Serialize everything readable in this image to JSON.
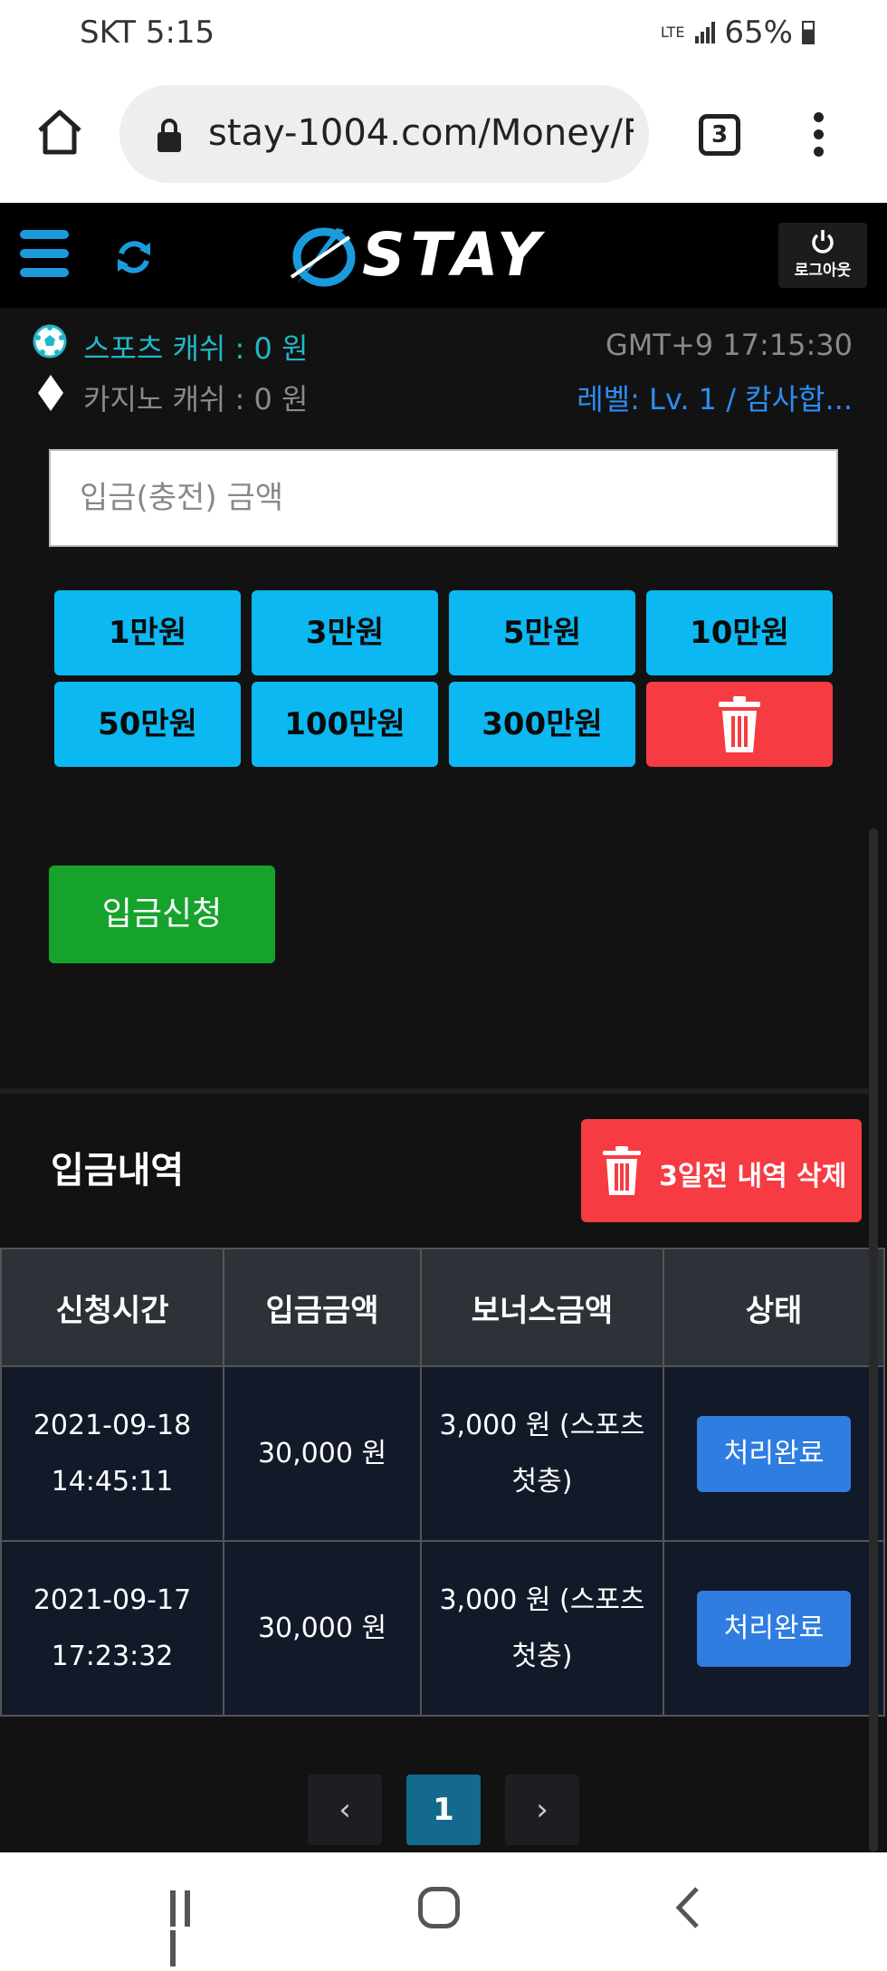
{
  "status_bar": {
    "carrier_time": "SKT  5:15",
    "network": "LTE",
    "battery": "65%"
  },
  "browser": {
    "url": "stay-1004.com/Money/F",
    "tab_count": "3"
  },
  "header": {
    "logo_text": "STAY",
    "logout_label": "로그아웃"
  },
  "info": {
    "sports_cash": "스포츠 캐쉬 :  0 원",
    "casino_cash": "카지노 캐쉬 :  0 원",
    "clock": "GMT+9 17:15:30",
    "level": "레벨: Lv. 1 / 캄사합..."
  },
  "form": {
    "amount_placeholder": "입금(충전) 금액",
    "amount_buttons": [
      "1만원",
      "3만원",
      "5만원",
      "10만원",
      "50만원",
      "100만원",
      "300만원"
    ],
    "submit_label": "입금신청"
  },
  "history": {
    "title": "입금내역",
    "delete_old_label": "3일전 내역 삭제",
    "columns": [
      "신청시간",
      "입금금액",
      "보너스금액",
      "상태"
    ],
    "rows": [
      {
        "date": "2021-09-18",
        "time": "14:45:11",
        "amount": "30,000 원",
        "bonus_1": "3,000 원 (스포츠",
        "bonus_2": "첫충)",
        "status": "처리완료"
      },
      {
        "date": "2021-09-17",
        "time": "17:23:32",
        "amount": "30,000 원",
        "bonus_1": "3,000 원 (스포츠",
        "bonus_2": "첫충)",
        "status": "처리완료"
      }
    ]
  },
  "pagination": {
    "prev": "‹",
    "current": "1",
    "next": "›"
  },
  "colors": {
    "accent": "#0cb8f2",
    "danger": "#f63b42",
    "success": "#16a32c",
    "status_blue": "#2f7de0"
  }
}
